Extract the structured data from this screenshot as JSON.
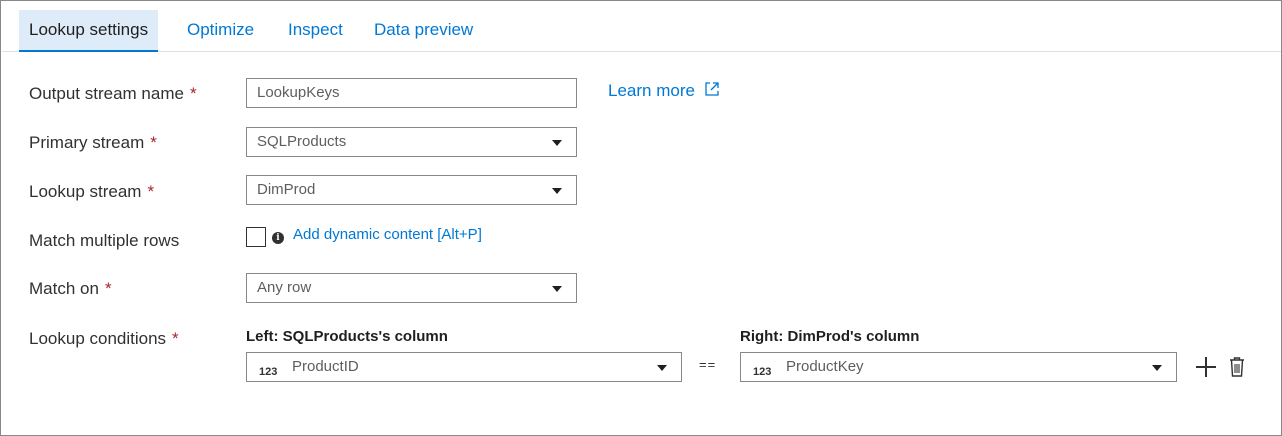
{
  "tabs": [
    {
      "label": "Lookup settings",
      "active": true
    },
    {
      "label": "Optimize"
    },
    {
      "label": "Inspect"
    },
    {
      "label": "Data preview"
    }
  ],
  "form": {
    "required_mark": "*",
    "output_stream": {
      "label": "Output stream name",
      "value": "LookupKeys"
    },
    "learn_more": "Learn more",
    "primary_stream": {
      "label": "Primary stream",
      "value": "SQLProducts"
    },
    "lookup_stream": {
      "label": "Lookup stream",
      "value": "DimProd"
    },
    "match_multiple": {
      "label": "Match multiple rows",
      "checked": false,
      "info_glyph": "i",
      "dynamic_content_link": "Add dynamic content [Alt+P]"
    },
    "match_on": {
      "label": "Match on",
      "value": "Any row"
    },
    "lookup_conditions": {
      "label": "Lookup conditions",
      "left_header": "Left: SQLProducts's column",
      "right_header": "Right: DimProd's column",
      "left_type": "123",
      "left_value": "ProductID",
      "operator": "==",
      "right_type": "123",
      "right_value": "ProductKey"
    }
  },
  "icons": {
    "external_link": "external-link-icon",
    "dropdown": "chevron-down-icon",
    "info": "info-icon",
    "add": "plus-icon",
    "delete": "trash-icon"
  },
  "colors": {
    "accent": "#0078d4",
    "active_tab_bg": "#deecf9",
    "required": "#a4262c",
    "border": "#8a8886"
  }
}
